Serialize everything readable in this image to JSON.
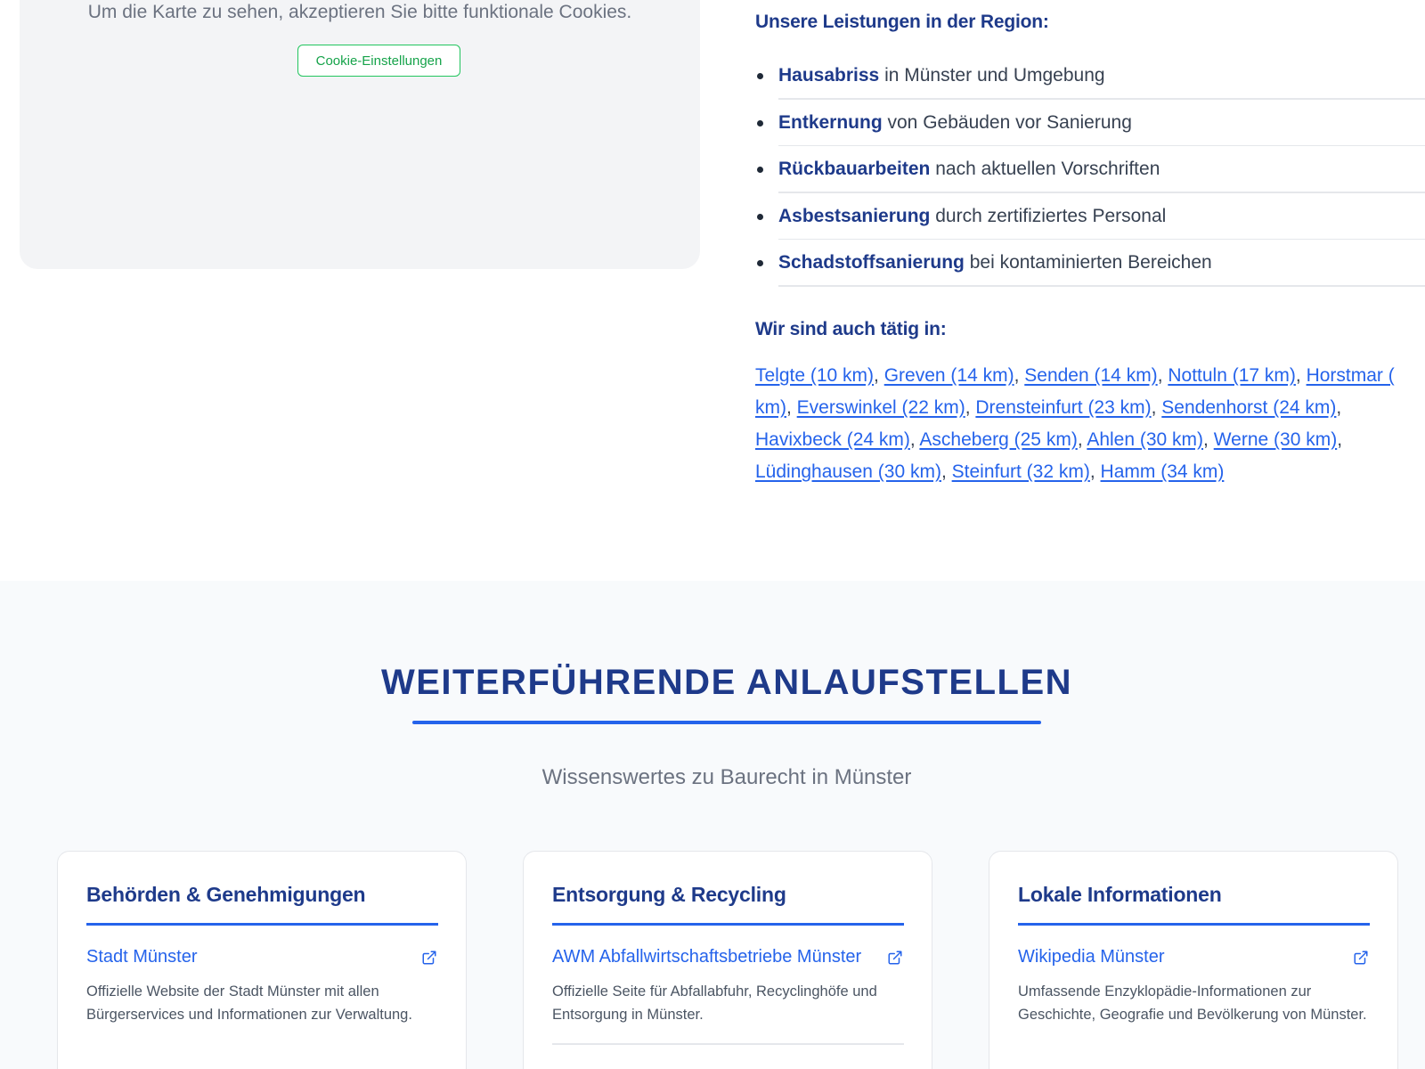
{
  "map": {
    "message": "Um die Karte zu sehen, akzeptieren Sie bitte funktionale Cookies.",
    "cookie_button": "Cookie-Einstellungen"
  },
  "region": {
    "services_heading": "Unsere Leistungen in der Region:",
    "services": [
      {
        "bold": "Hausabriss",
        "text": " in Münster und Umgebung"
      },
      {
        "bold": "Entkernung",
        "text": " von Gebäuden vor Sanierung"
      },
      {
        "bold": "Rückbauarbeiten",
        "text": " nach aktuellen Vorschriften"
      },
      {
        "bold": "Asbestsanierung",
        "text": " durch zertifiziertes Personal"
      },
      {
        "bold": "Schadstoffsanierung",
        "text": " bei kontaminierten Bereichen"
      }
    ],
    "towns_heading": "Wir sind auch tätig in:",
    "towns": [
      "Telgte (10 km)",
      "Greven (14 km)",
      "Senden (14 km)",
      "Nottuln (17 km)",
      "Horstmar (",
      "km)",
      "Everswinkel (22 km)",
      "Drensteinfurt (23 km)",
      "Sendenhorst (24 km)",
      "Havixbeck (24 km)",
      "Ascheberg (25 km)",
      "Ahlen (30 km)",
      "Werne (30 km)",
      "Lüdinghausen (30 km)",
      "Steinfurt (32 km)",
      "Hamm (34 km)"
    ]
  },
  "resources": {
    "title": "WEITERFÜHRENDE ANLAUFSTELLEN",
    "subtitle": "Wissenswertes zu Baurecht in Münster",
    "cards": [
      {
        "title": "Behörden & Genehmigungen",
        "link": "Stadt Münster",
        "description": "Offizielle Website der Stadt Münster mit allen Bürgerservices und Informationen zur Verwaltung."
      },
      {
        "title": "Entsorgung & Recycling",
        "link": "AWM Abfallwirtschaftsbetriebe Münster",
        "description": "Offizielle Seite für Abfallabfuhr, Recyclinghöfe und Entsorgung in Münster."
      },
      {
        "title": "Lokale Informationen",
        "link": "Wikipedia Münster",
        "description": "Umfassende Enzyklopädie-Informationen zur Geschichte, Geografie und Bevölkerung von Münster."
      }
    ]
  },
  "colors": {
    "navy": "#1e3a8a",
    "link_blue": "#2563eb",
    "cookie_green": "#16a34a",
    "section_bg": "#f8fafc"
  },
  "icons": {
    "external_link": "external-link-icon",
    "bullet": "bullet-dot"
  }
}
